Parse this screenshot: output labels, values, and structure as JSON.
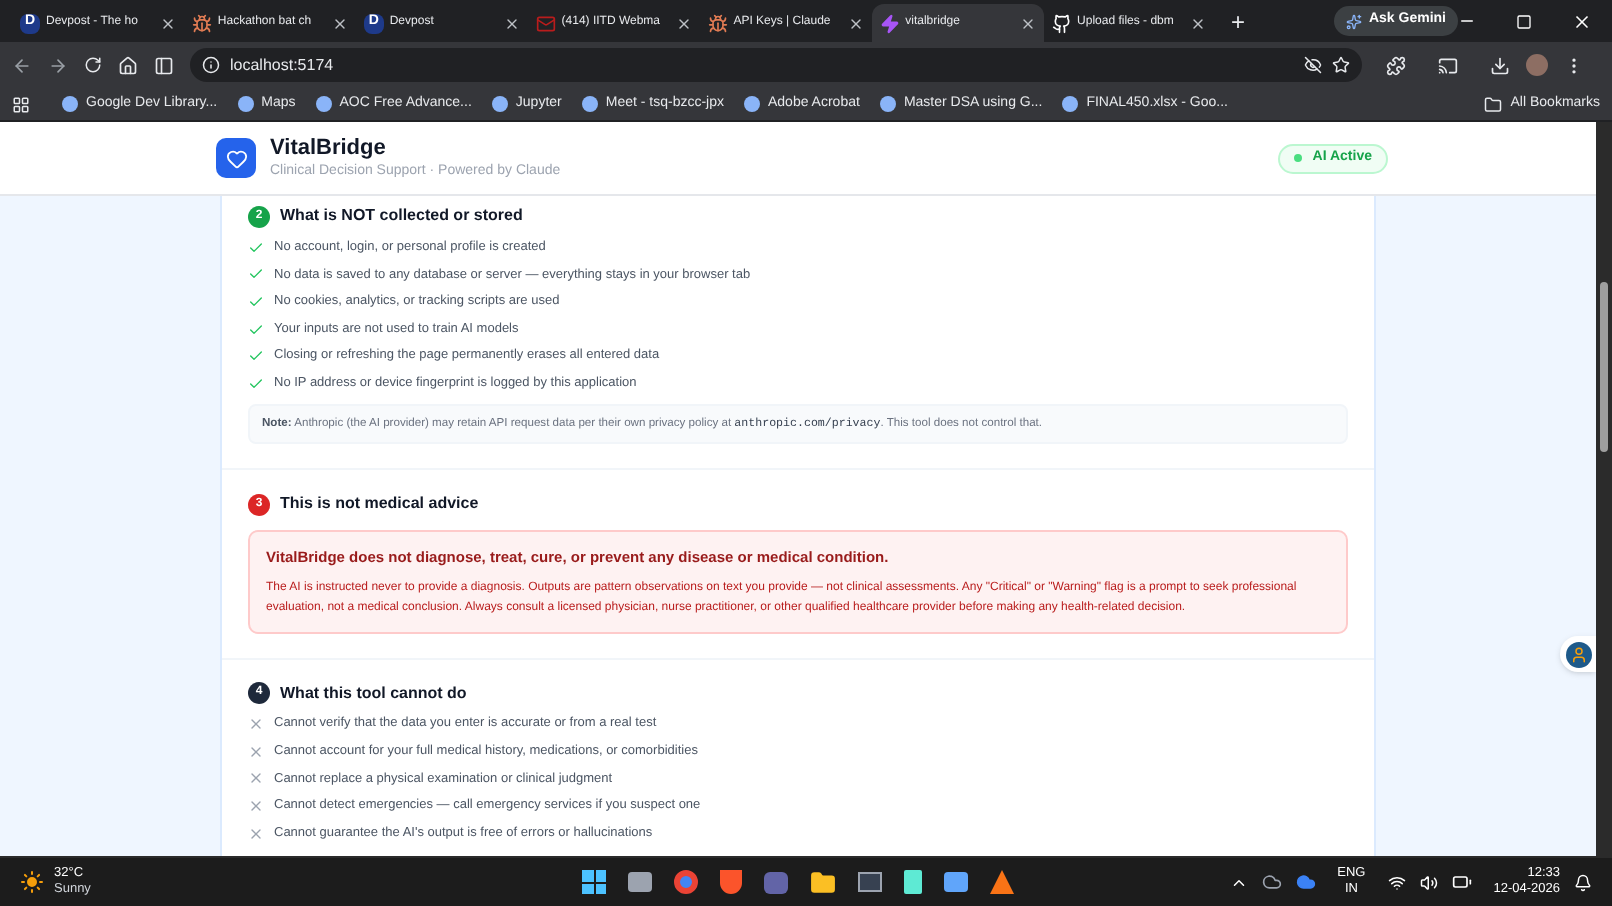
{
  "browser": {
    "tabs": [
      {
        "title": "Devpost - The ho",
        "kind": "letter",
        "letter": "D",
        "selected": false
      },
      {
        "title": "Hackathon bat ch",
        "kind": "bug",
        "selected": false
      },
      {
        "title": "Devpost",
        "kind": "letter",
        "letter": "D",
        "selected": false
      },
      {
        "title": "(414) IITD Webma",
        "kind": "mail",
        "selected": false
      },
      {
        "title": "API Keys | Claude",
        "kind": "bug",
        "selected": false
      },
      {
        "title": "vitalbridge",
        "kind": "bolt",
        "selected": true
      },
      {
        "title": "Upload files - dbm",
        "kind": "github",
        "selected": false
      }
    ],
    "new_tab": "+",
    "gemini": "Ask Gemini",
    "address": "localhost:5174",
    "bookmarks": [
      "Google Dev Library...",
      "Maps",
      "AOC Free Advance...",
      "Jupyter",
      "Meet - tsq-bzcc-jpx",
      "Adobe Acrobat",
      "Master DSA using G...",
      "FINAL450.xlsx - Goo..."
    ],
    "all_bookmarks": "All Bookmarks"
  },
  "header": {
    "title": "VitalBridge",
    "subtitle": "Clinical Decision Support · Powered by Claude",
    "status": "AI Active"
  },
  "sections": [
    {
      "number": "2",
      "color": "#16a34a",
      "title": "What is NOT collected or stored",
      "items": [
        {
          "kind": "check",
          "text": "No account, login, or personal profile is created"
        },
        {
          "kind": "check",
          "text": "No data is saved to any database or server — everything stays in your browser tab"
        },
        {
          "kind": "check",
          "text": "No cookies, analytics, or tracking scripts are used"
        },
        {
          "kind": "check",
          "text": "Your inputs are not used to train AI models"
        },
        {
          "kind": "check",
          "text": "Closing or refreshing the page permanently erases all entered data"
        },
        {
          "kind": "check",
          "text": "No IP address or device fingerprint is logged by this application"
        }
      ],
      "note": {
        "label": "Note:",
        "before": " Anthropic (the AI provider) may retain API request data per their own privacy policy at ",
        "code": "anthropic.com/privacy",
        "after": ". This tool does not control that."
      }
    },
    {
      "number": "3",
      "color": "#dc2626",
      "title": "This is not medical advice",
      "alert": {
        "title": "VitalBridge does not diagnose, treat, cure, or prevent any disease or medical condition.",
        "body": "The AI is instructed never to provide a diagnosis. Outputs are pattern observations on text you provide — not clinical assessments. Any \"Critical\" or \"Warning\" flag is a prompt to seek professional evaluation, not a medical conclusion. Always consult a licensed physician, nurse practitioner, or other qualified healthcare provider before making any health-related decision."
      }
    },
    {
      "number": "4",
      "color": "#1e293b",
      "title": "What this tool cannot do",
      "items": [
        {
          "kind": "cross",
          "text": "Cannot verify that the data you enter is accurate or from a real test"
        },
        {
          "kind": "cross",
          "text": "Cannot account for your full medical history, medications, or comorbidities"
        },
        {
          "kind": "cross",
          "text": "Cannot replace a physical examination or clinical judgment"
        },
        {
          "kind": "cross",
          "text": "Cannot detect emergencies — call emergency services if you suspect one"
        },
        {
          "kind": "cross",
          "text": "Cannot guarantee the AI's output is free of errors or hallucinations"
        }
      ]
    }
  ],
  "taskbar": {
    "temperature": "32°C",
    "weather": "Sunny",
    "language": "ENG",
    "region": "IN",
    "time": "12:33",
    "date": "12-04-2026"
  }
}
